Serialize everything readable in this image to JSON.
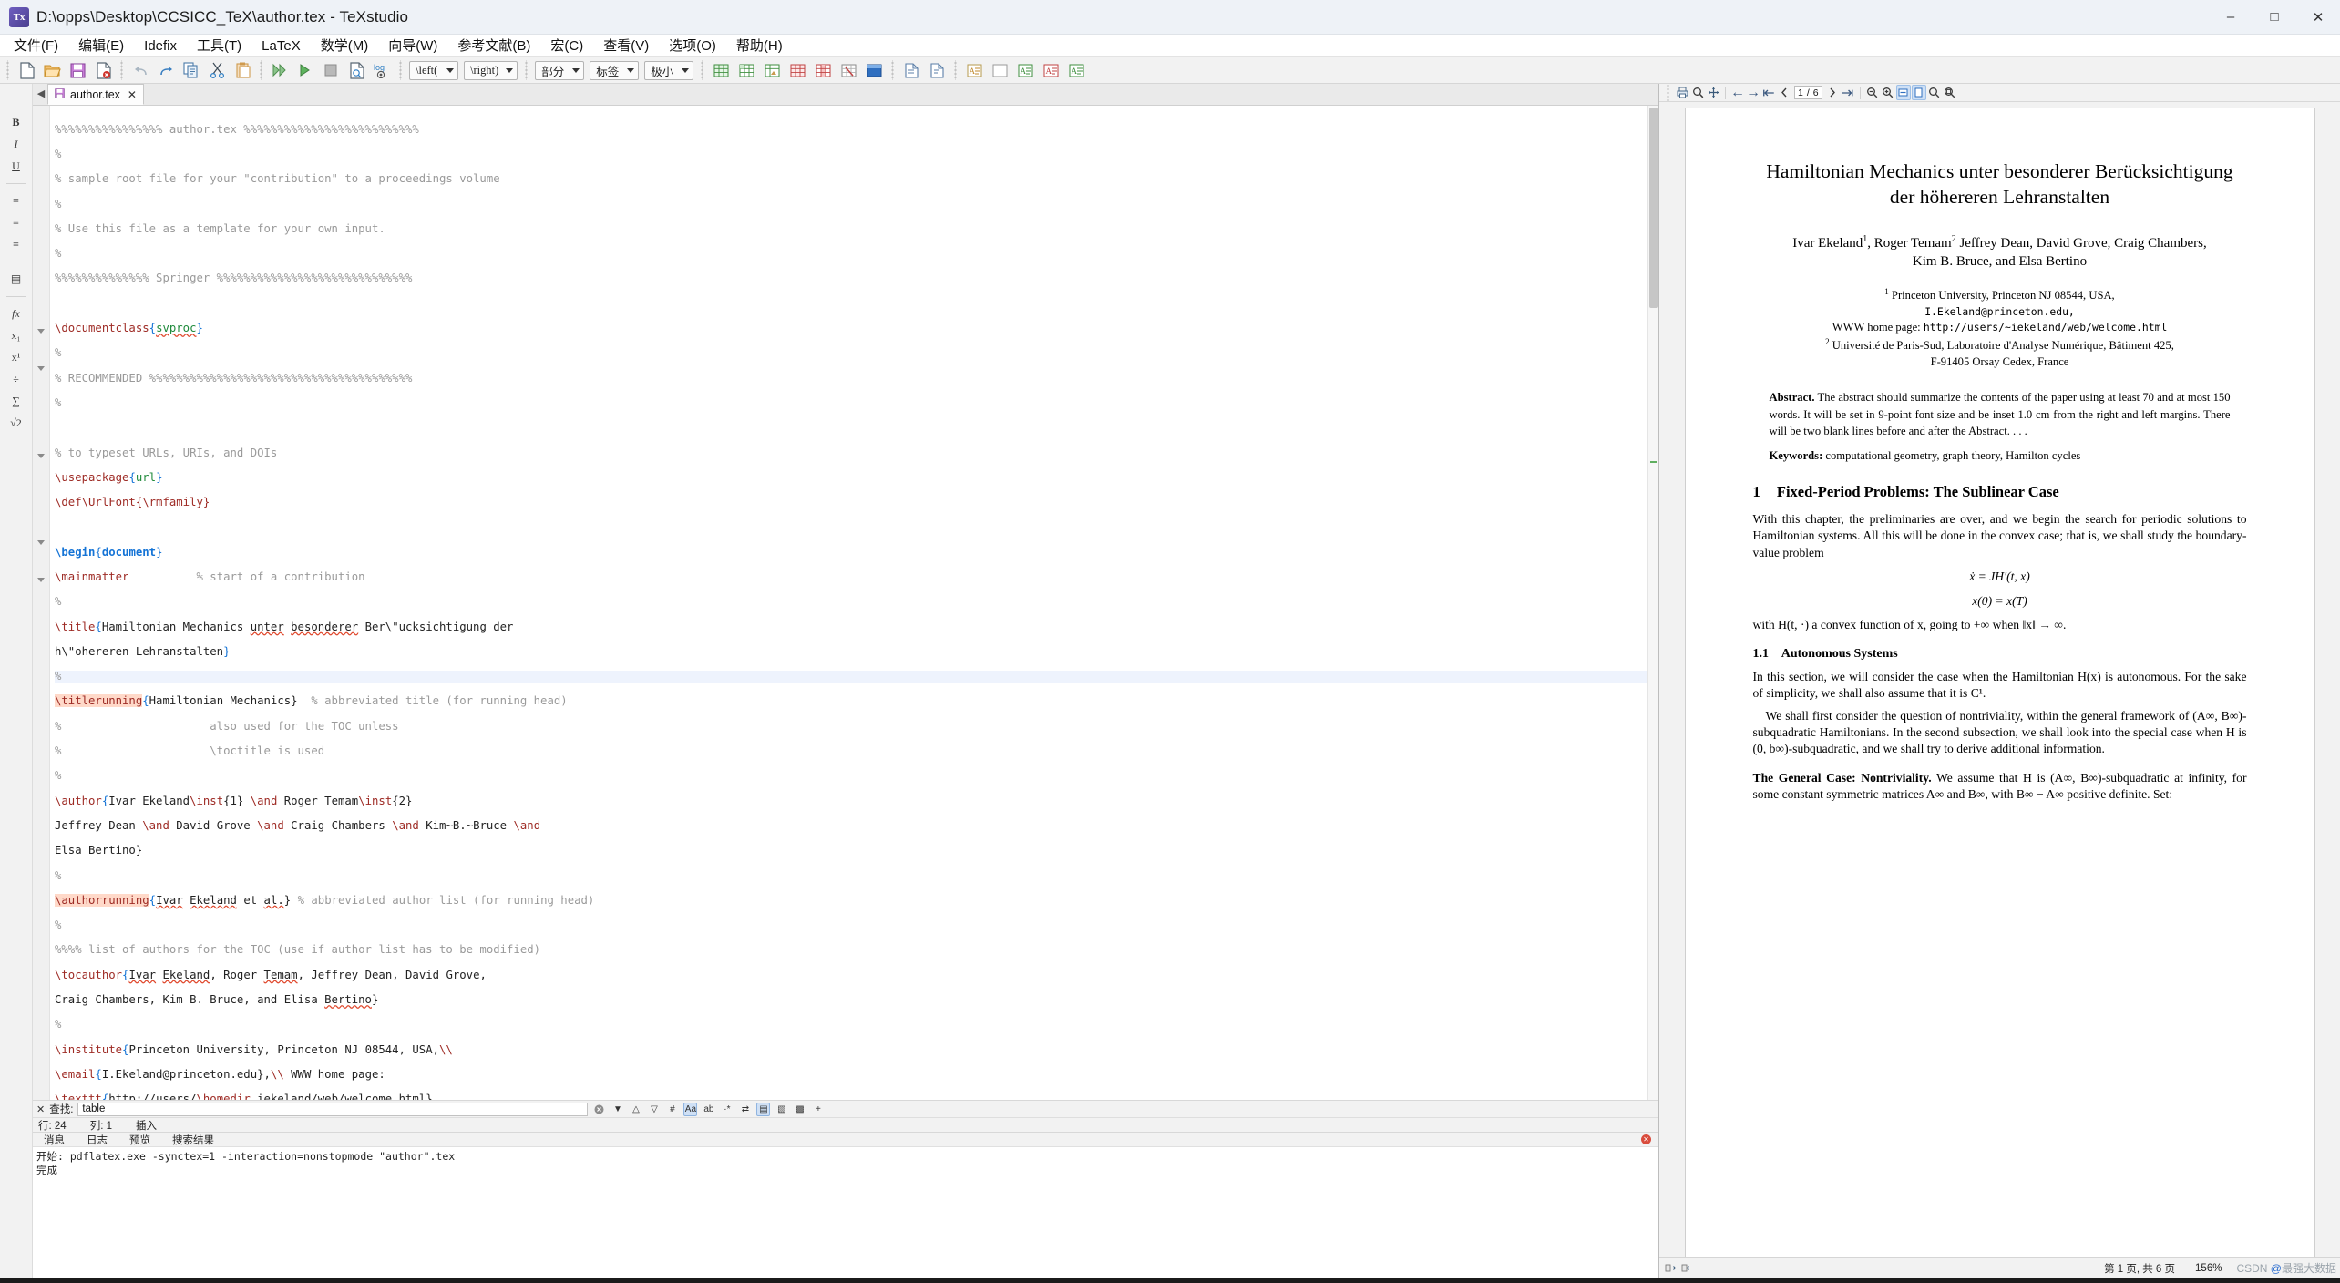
{
  "window": {
    "title": "D:\\opps\\Desktop\\CCSICC_TeX\\author.tex - TeXstudio",
    "app_icon_text": "Tx",
    "minimize": "–",
    "maximize": "□",
    "close": "✕"
  },
  "menu": [
    {
      "label": "文件(F)"
    },
    {
      "label": "编辑(E)"
    },
    {
      "label": "Idefix"
    },
    {
      "label": "工具(T)"
    },
    {
      "label": "LaTeX"
    },
    {
      "label": "数学(M)"
    },
    {
      "label": "向导(W)"
    },
    {
      "label": "参考文献(B)"
    },
    {
      "label": "宏(C)"
    },
    {
      "label": "查看(V)"
    },
    {
      "label": "选项(O)"
    },
    {
      "label": "帮助(H)"
    }
  ],
  "toolbar": {
    "groups": [
      [
        "new-file-icon",
        "open-folder-icon",
        "save-icon",
        "close-file-icon"
      ],
      [
        "undo-icon",
        "redo-icon",
        "copy-icon",
        "cut-icon",
        "paste-icon"
      ],
      [
        "build-and-view-icon",
        "compile-icon",
        "stop-icon",
        "view-pdf-icon",
        "view-log-icon"
      ]
    ],
    "selects": [
      {
        "name": "left-delimiter-select",
        "value": "\\left("
      },
      {
        "name": "right-delimiter-select",
        "value": "\\right)"
      },
      {
        "name": "section-level-select",
        "value": "部分"
      },
      {
        "name": "label-select",
        "value": "标签"
      },
      {
        "name": "font-size-select",
        "value": "极小"
      }
    ],
    "table_icons": [
      "table-insert-icon",
      "table-grid-icon",
      "table-image-icon",
      "table-row-icon",
      "table-col-icon",
      "table-delete-icon",
      "table-block-icon"
    ],
    "doc_icons": [
      "insert-graphic-icon",
      "insert-file-icon"
    ],
    "text_icons": [
      "text-format-a-icon",
      "clear-format-icon",
      "highlight-green-icon",
      "highlight-red-icon",
      "highlight-orange-icon"
    ]
  },
  "structure_rail": [
    {
      "name": "bold-icon",
      "glyph": "B"
    },
    {
      "name": "italic-icon",
      "glyph": "I"
    },
    {
      "name": "underline-icon",
      "glyph": "U"
    },
    {
      "name": "align-left-icon",
      "glyph": "≡"
    },
    {
      "name": "align-center-icon",
      "glyph": "≡"
    },
    {
      "name": "align-right-icon",
      "glyph": "≡"
    },
    {
      "name": "list-icon",
      "glyph": "▤"
    },
    {
      "name": "function-icon",
      "glyph": "fx"
    },
    {
      "name": "subscript-icon",
      "glyph": "x₁"
    },
    {
      "name": "superscript-icon",
      "glyph": "x¹"
    },
    {
      "name": "fraction-icon",
      "glyph": "÷"
    },
    {
      "name": "sum-icon",
      "glyph": "∑"
    },
    {
      "name": "sqrt-icon",
      "glyph": "√2"
    }
  ],
  "editor": {
    "tab": {
      "label": "author.tex",
      "close": "✕",
      "icon": "save-modified-icon"
    },
    "nav_prev": "◀",
    "nav_next": "▶",
    "lines": [
      {
        "t": "cm",
        "text": "%%%%%%%%%%%%%%%% author.tex %%%%%%%%%%%%%%%%%%%%%%%%%%"
      },
      {
        "t": "cm",
        "text": "%"
      },
      {
        "t": "cm",
        "text": "% sample root file for your \"contribution\" to a proceedings volume"
      },
      {
        "t": "cm",
        "text": "%"
      },
      {
        "t": "cm",
        "text": "% Use this file as a template for your own input."
      },
      {
        "t": "cm",
        "text": "%"
      },
      {
        "t": "cm",
        "text": "%%%%%%%%%%%%%% Springer %%%%%%%%%%%%%%%%%%%%%%%%%%%%%"
      },
      {
        "t": "blank",
        "text": ""
      },
      {
        "t": "cmd_arg_spell",
        "cmd": "\\documentclass",
        "arg": "svproc"
      },
      {
        "t": "cm",
        "text": "%"
      },
      {
        "t": "cm",
        "text": "% RECOMMENDED %%%%%%%%%%%%%%%%%%%%%%%%%%%%%%%%%%%%%%%"
      },
      {
        "t": "cm",
        "text": "%"
      },
      {
        "t": "blank",
        "text": ""
      },
      {
        "t": "cm",
        "text": "% to typeset URLs, URIs, and DOIs"
      },
      {
        "t": "cmd_arg",
        "cmd": "\\usepackage",
        "arg": "url"
      },
      {
        "t": "raw_def",
        "text": "\\def\\UrlFont{\\rmfamily}"
      },
      {
        "t": "blank",
        "text": ""
      },
      {
        "t": "begin",
        "cmd": "\\begin",
        "arg": "document",
        "fold": true
      },
      {
        "t": "cmd_comment",
        "cmd": "\\mainmatter",
        "pad": "          ",
        "comment": "% start of a contribution"
      },
      {
        "t": "cm",
        "text": "%"
      },
      {
        "t": "title1",
        "fold": true
      },
      {
        "t": "title2"
      },
      {
        "t": "cm_hl",
        "text": "%"
      },
      {
        "t": "titlerunning"
      },
      {
        "t": "cm_indent",
        "text": "%                      also used for the TOC unless"
      },
      {
        "t": "cm_indent",
        "text": "%                      \\toctitle is used"
      },
      {
        "t": "cm",
        "text": "%"
      },
      {
        "t": "author1",
        "fold": true
      },
      {
        "t": "author2"
      },
      {
        "t": "author3"
      },
      {
        "t": "cm",
        "text": "%"
      },
      {
        "t": "authorrunning"
      },
      {
        "t": "cm",
        "text": "%"
      },
      {
        "t": "cm",
        "text": "%%%% list of authors for the TOC (use if author list has to be modified)"
      },
      {
        "t": "tocauthor1",
        "fold": true
      },
      {
        "t": "tocauthor2"
      },
      {
        "t": "cm",
        "text": "%"
      },
      {
        "t": "institute1",
        "fold": true
      },
      {
        "t": "institute2"
      },
      {
        "t": "institute3"
      },
      {
        "t": "institute4"
      },
      {
        "t": "institute5"
      },
      {
        "t": "institute6"
      }
    ]
  },
  "find": {
    "close": "✕",
    "label": "查找:",
    "value": "table",
    "clear": "✕",
    "dropdown": "▼",
    "prev": "△",
    "next": "▽",
    "hash": "#",
    "buttons": [
      "Aa",
      "ab",
      "·*",
      "⇄",
      "▤",
      "▧",
      "▩",
      "+"
    ]
  },
  "status": {
    "row_label": "行:",
    "row_value": "24",
    "col_label": "列:",
    "col_value": "1",
    "mode": "插入"
  },
  "messages": {
    "tabs": [
      "消息",
      "日志",
      "预览",
      "搜索结果"
    ],
    "close": "✕",
    "line1": "开始: pdflatex.exe -synctex=1 -interaction=nonstopmode \"author\".tex",
    "line2": "完成"
  },
  "pdf": {
    "toolbar": {
      "grip": "⋮",
      "print_icon": "print-icon",
      "find_icon": "search-icon",
      "pan_icon": "pan-icon",
      "prev_page_icon": "←",
      "next_page_icon": "→",
      "first_page_icon": "⇤",
      "last_page_icon": "⇥",
      "page_current": "1",
      "page_sep": "/",
      "page_total": "6",
      "zoom_out_icon": "−",
      "zoom_in_icon": "+",
      "fit_width_icon": "fit-width-icon",
      "fit_page_icon": "fit-page-icon",
      "magnifier_icon": "magnifier-icon",
      "zoom_select_icon": "zoom-select-icon"
    },
    "document": {
      "title": "Hamiltonian Mechanics unter besonderer Berücksichtigung der höhereren Lehranstalten",
      "authors": "Ivar Ekeland1, Roger Temam2 Jeffrey Dean, David Grove, Craig Chambers, Kim B. Bruce, and Elsa Bertino",
      "aff1_sup": "1",
      "aff1": "Princeton University, Princeton NJ 08544, USA,",
      "aff1_email": "I.Ekeland@princeton.edu,",
      "aff1_www_label": "WWW home page:",
      "aff1_www": "http://users/~iekeland/web/welcome.html",
      "aff2_sup": "2",
      "aff2": "Université de Paris-Sud, Laboratoire d'Analyse Numérique, Bâtiment 425,",
      "aff2b": "F-91405 Orsay Cedex, France",
      "abstract_label": "Abstract.",
      "abstract": "The abstract should summarize the contents of the paper using at least 70 and at most 150 words. It will be set in 9-point font size and be inset 1.0 cm from the right and left margins. There will be two blank lines before and after the Abstract. . . .",
      "keywords_label": "Keywords:",
      "keywords": "computational geometry, graph theory, Hamilton cycles",
      "sec1_num": "1",
      "sec1_title": "Fixed-Period Problems: The Sublinear Case",
      "p1": "With this chapter, the preliminaries are over, and we begin the search for periodic solutions to Hamiltonian systems. All this will be done in the convex case; that is, we shall study the boundary-value problem",
      "eq1": "ẋ = JH′(t, x)",
      "eq2": "x(0) = x(T)",
      "p2": "with H(t, ·) a convex function of x, going to +∞ when ‖x‖ → ∞.",
      "sub11_num": "1.1",
      "sub11_title": "Autonomous Systems",
      "p3": "In this section, we will consider the case when the Hamiltonian H(x) is autonomous. For the sake of simplicity, we shall also assume that it is C¹.",
      "p4": "We shall first consider the question of nontriviality, within the general framework of (A∞, B∞)-subquadratic Hamiltonians. In the second subsection, we shall look into the special case when H is (0, b∞)-subquadratic, and we shall try to derive additional information.",
      "p5_run": "The General Case: Nontriviality.",
      "p5": "We assume that H is (A∞, B∞)-subquadratic at infinity, for some constant symmetric matrices A∞ and B∞, with B∞ − A∞ positive definite. Set:"
    },
    "status": {
      "sync_icon": "sync-icon",
      "link_icon": "link-icon",
      "page_info": "第 1 页, 共 6 页",
      "zoom": "156%",
      "watermark": "CSDN @最强大数据"
    }
  }
}
